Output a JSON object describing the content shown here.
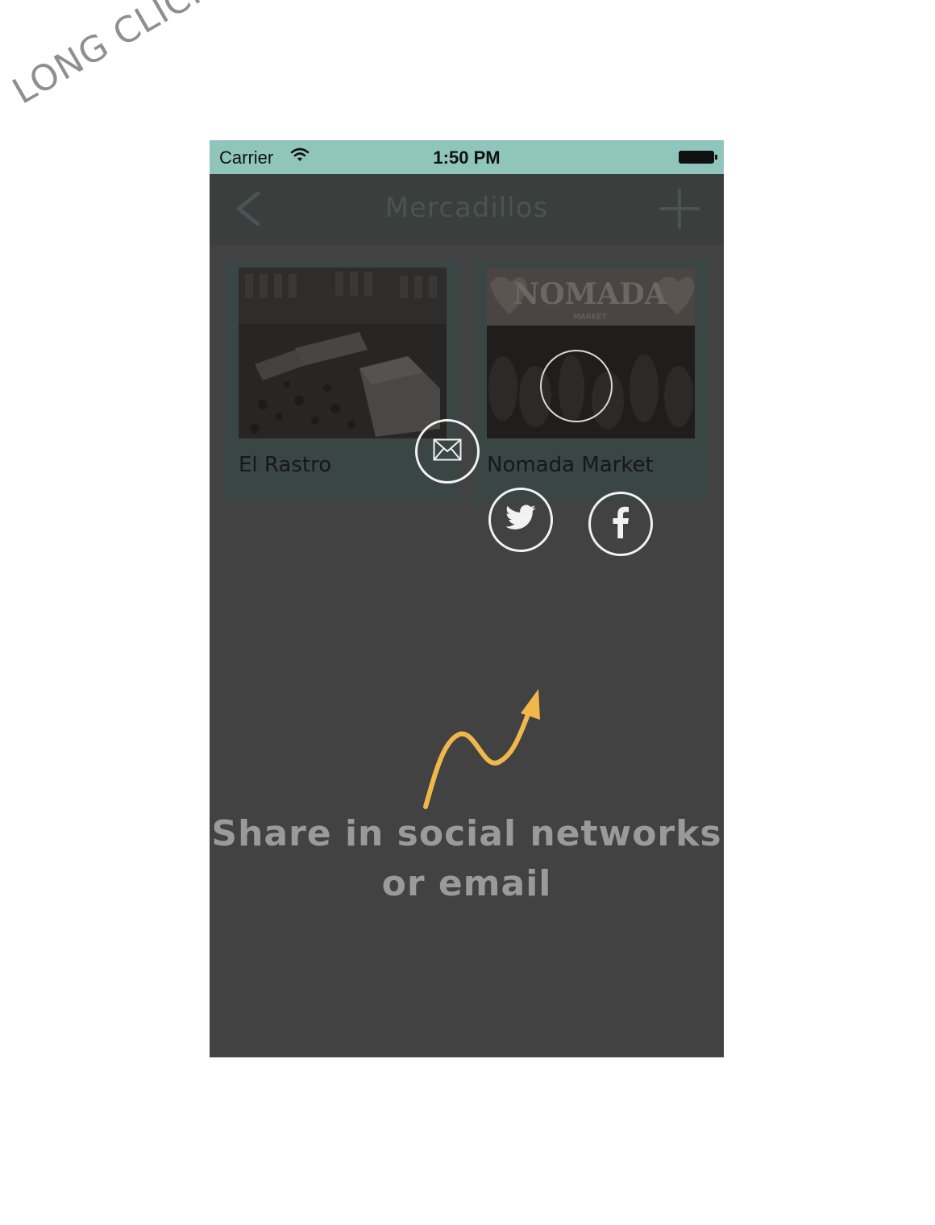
{
  "annotation": {
    "title": "LONG CLICK"
  },
  "status_bar": {
    "carrier": "Carrier",
    "time": "1:50 PM"
  },
  "nav": {
    "title": "Mercadillos",
    "back_icon": "chevron-left-icon",
    "add_icon": "plus-icon"
  },
  "markets": [
    {
      "label": "El Rastro"
    },
    {
      "label": "Nomada Market",
      "sign_text": "NOMADA",
      "sign_subtext": "MARKET"
    }
  ],
  "share_menu": {
    "icons": [
      "mail-icon",
      "twitter-icon",
      "facebook-icon"
    ]
  },
  "hint": {
    "line1": "Share in social networks",
    "line2": "or email"
  },
  "colors": {
    "status_bar": "#8fc5bb",
    "overlay": "#424242",
    "card": "#3a4644",
    "hint_text": "#9a9a9a",
    "arrow": "#f0b84a"
  }
}
